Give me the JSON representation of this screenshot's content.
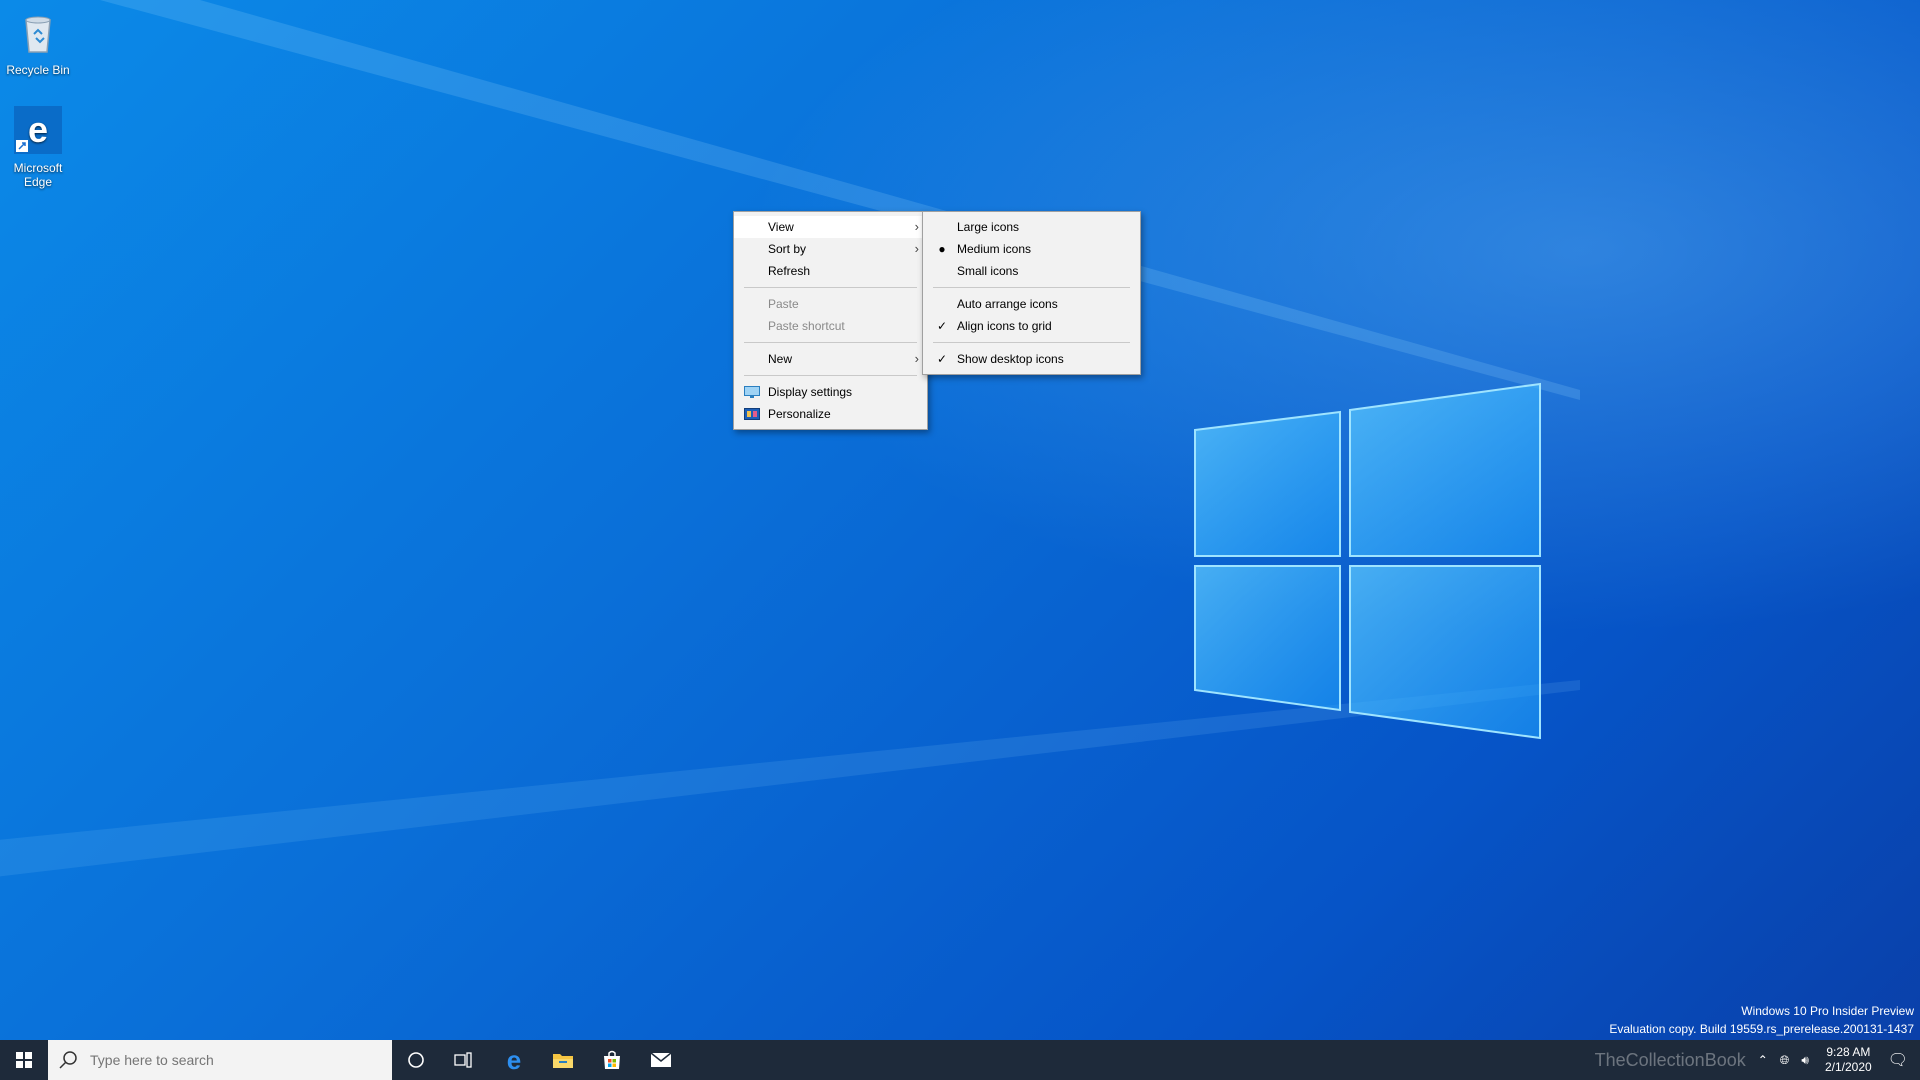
{
  "desktop": {
    "icons": [
      {
        "label": "Recycle Bin",
        "icon": "recycle-bin-icon"
      },
      {
        "label": "Microsoft Edge",
        "icon": "edge-icon"
      }
    ]
  },
  "context_menu": {
    "items": [
      {
        "label": "View",
        "has_submenu": true,
        "highlighted": true
      },
      {
        "label": "Sort by",
        "has_submenu": true
      },
      {
        "label": "Refresh"
      },
      {
        "label": "Paste",
        "disabled": true
      },
      {
        "label": "Paste shortcut",
        "disabled": true
      },
      {
        "label": "New",
        "has_submenu": true
      },
      {
        "label": "Display settings",
        "icon": "display-settings-icon"
      },
      {
        "label": "Personalize",
        "icon": "personalize-icon"
      }
    ]
  },
  "view_submenu": {
    "items": [
      {
        "label": "Large icons"
      },
      {
        "label": "Medium icons",
        "mark": "bullet"
      },
      {
        "label": "Small icons"
      },
      {
        "label": "Auto arrange icons"
      },
      {
        "label": "Align icons to grid",
        "mark": "check"
      },
      {
        "label": "Show desktop icons",
        "mark": "check"
      }
    ]
  },
  "taskbar": {
    "search_placeholder": "Type here to search",
    "pinned": [
      "cortana-icon",
      "task-view-icon",
      "edge-icon",
      "file-explorer-icon",
      "store-icon",
      "mail-icon"
    ],
    "clock": {
      "time": "9:28 AM",
      "date": "2/1/2020"
    }
  },
  "watermark": {
    "line1": "Windows 10 Pro Insider Preview",
    "line2": "Evaluation copy. Build 19559.rs_prerelease.200131-1437",
    "brand": "TheCollectionBook"
  },
  "colors": {
    "accent": "#0078d7",
    "taskbar": "#1e2a3a",
    "menu_bg": "#f2f2f2"
  }
}
